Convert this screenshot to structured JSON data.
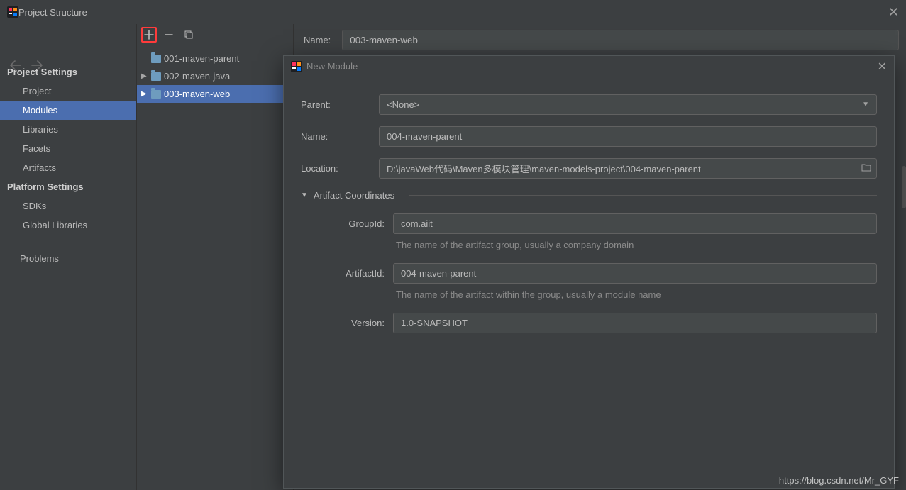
{
  "window": {
    "title": "Project Structure"
  },
  "sidebar": {
    "sections": [
      {
        "header": "Project Settings",
        "items": [
          "Project",
          "Modules",
          "Libraries",
          "Facets",
          "Artifacts"
        ]
      },
      {
        "header": "Platform Settings",
        "items": [
          "SDKs",
          "Global Libraries"
        ]
      }
    ],
    "problems": "Problems",
    "selected": "Modules"
  },
  "toolbar": {
    "add_tooltip": "Add",
    "remove_tooltip": "Remove",
    "copy_tooltip": "Copy"
  },
  "tree": {
    "items": [
      {
        "label": "001-maven-parent",
        "expandable": false
      },
      {
        "label": "002-maven-java",
        "expandable": true
      },
      {
        "label": "003-maven-web",
        "expandable": true
      }
    ],
    "selected": "003-maven-web"
  },
  "detail": {
    "name_label": "Name:",
    "name_value": "003-maven-web"
  },
  "dialog": {
    "title": "New Module",
    "fields": {
      "parent_label": "Parent:",
      "parent_value": "<None>",
      "name_label": "Name:",
      "name_value": "004-maven-parent",
      "location_label": "Location:",
      "location_value": "D:\\javaWeb代码\\Maven多模块管理\\maven-models-project\\004-maven-parent"
    },
    "coords": {
      "header": "Artifact Coordinates",
      "group_label": "GroupId:",
      "group_value": "com.aiit",
      "group_hint": "The name of the artifact group, usually a company domain",
      "artifact_label": "ArtifactId:",
      "artifact_value": "004-maven-parent",
      "artifact_hint": "The name of the artifact within the group, usually a module name",
      "version_label": "Version:",
      "version_value": "1.0-SNAPSHOT"
    }
  },
  "watermark": "https://blog.csdn.net/Mr_GYF"
}
